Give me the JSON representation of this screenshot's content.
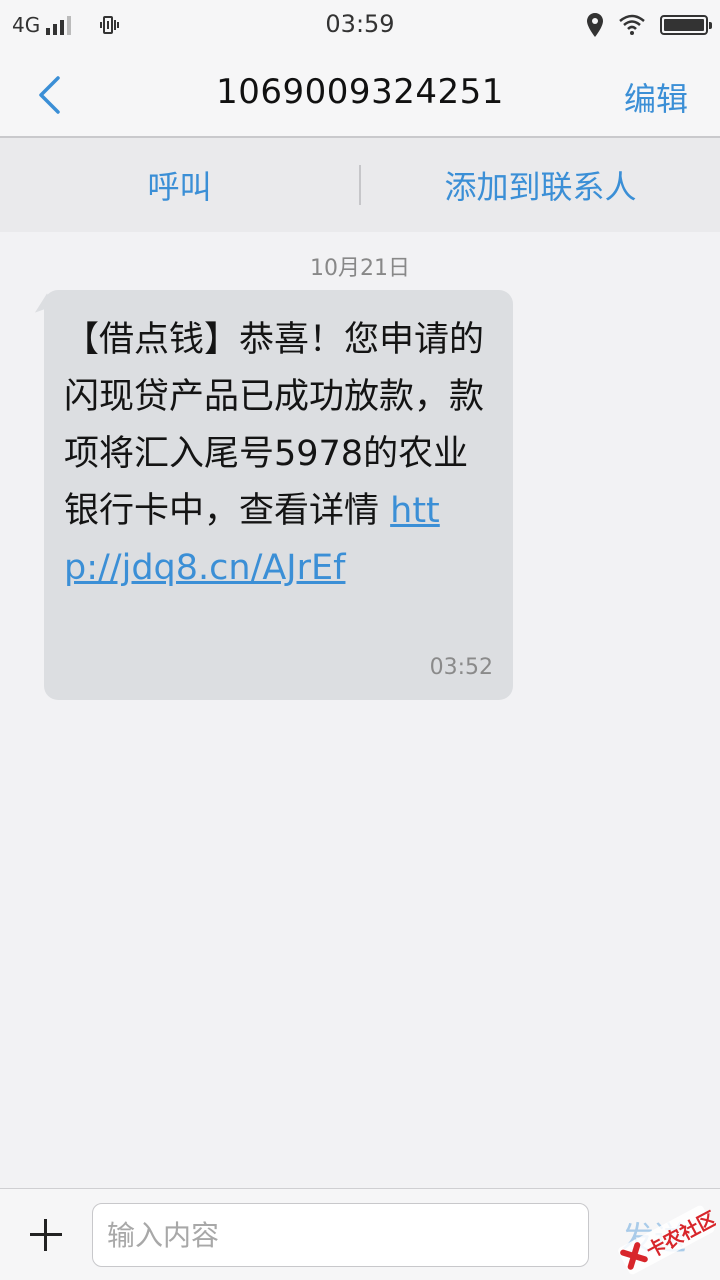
{
  "status_bar": {
    "network": "4G",
    "time": "03:59"
  },
  "nav": {
    "title": "1069009324251",
    "edit_label": "编辑"
  },
  "actions": {
    "call_label": "呼叫",
    "add_contact_label": "添加到联系人"
  },
  "conversation": {
    "date": "10月21日",
    "message": {
      "text": "【借点钱】恭喜！您申请的闪现贷产品已成功放款，款项将汇入尾号5978的农业银行卡中，查看详情 ",
      "link": "http://jdq8.cn/AJrEf",
      "time": "03:52"
    }
  },
  "composer": {
    "placeholder": "输入内容",
    "send_label": "发送"
  },
  "watermark": {
    "text": "卡农社区"
  },
  "colors": {
    "accent": "#3b8fd6",
    "bubble": "#dcdee1",
    "background": "#f2f2f4"
  }
}
